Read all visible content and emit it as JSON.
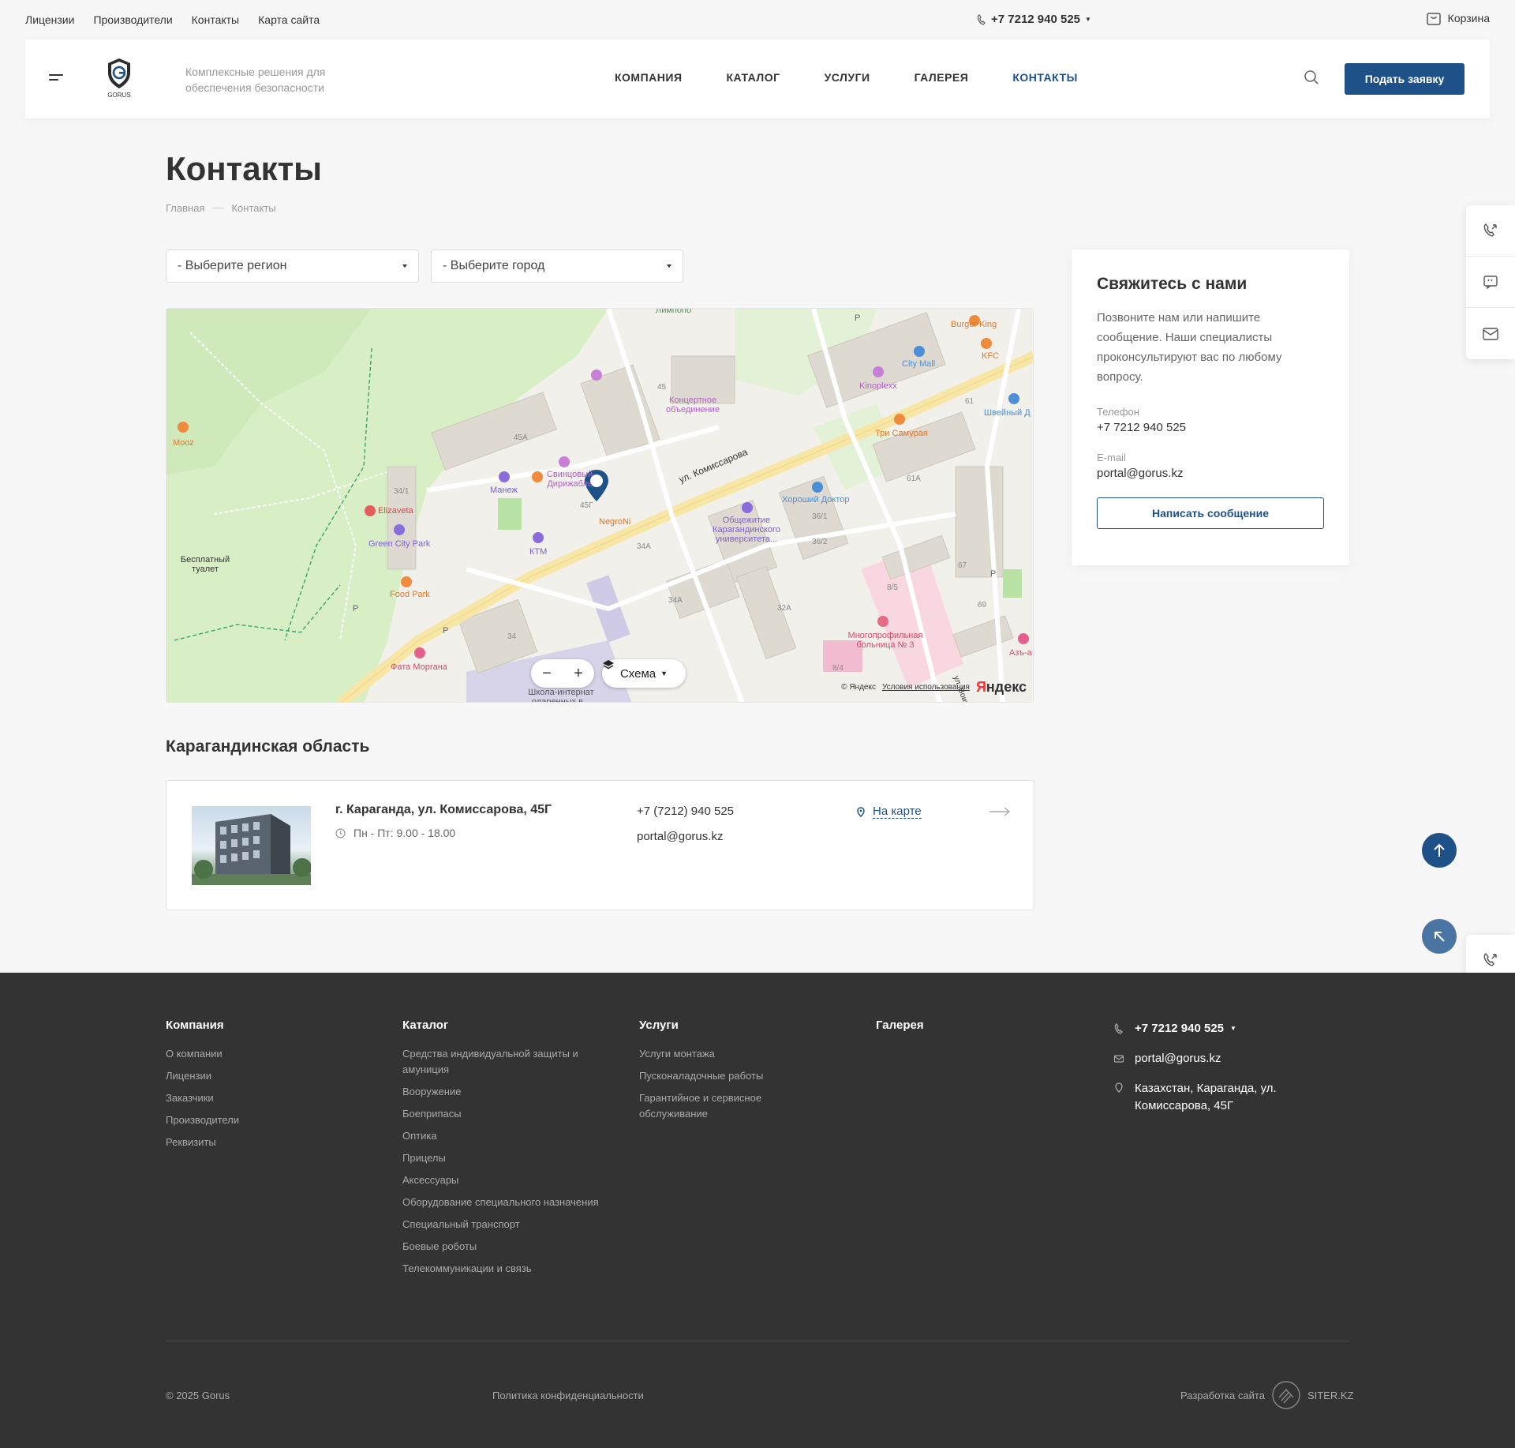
{
  "topbar": {
    "links": [
      "Лицензии",
      "Производители",
      "Контакты",
      "Карта сайта"
    ],
    "phone": "+7 7212 940 525",
    "cart": "Корзина"
  },
  "header": {
    "logo_text": "GORUS",
    "slogan": "Комплексные решения для обеспечения безопасности",
    "nav": [
      "КОМПАНИЯ",
      "КАТАЛОГ",
      "УСЛУГИ",
      "ГАЛЕРЕЯ",
      "КОНТАКТЫ"
    ],
    "apply_button": "Подать заявку"
  },
  "page": {
    "title": "Контакты",
    "breadcrumb": [
      "Главная",
      "Контакты"
    ]
  },
  "filters": {
    "region": "- Выберите регион",
    "city": "- Выберите город"
  },
  "map": {
    "labels": [
      "Лимпопо",
      "Burger King",
      "City Mall",
      "KFC",
      "Kinoplexx",
      "Концертное объединение",
      "45",
      "61",
      "Швейный Д",
      "Mooz",
      "45А",
      "Манеж",
      "Три Самурая",
      "Свинцовый Дирижабль",
      "ул. Комиссарова",
      "34/1",
      "Elizaveta",
      "45Г",
      "NegroNi",
      "Хороший Доктор",
      "61А",
      "Green City Park",
      "КТМ",
      "Общежитие Карагандинского университета...",
      "36/1",
      "36/2",
      "34А",
      "Бесплатный туалет",
      "Food Park",
      "8/5",
      "67",
      "34А",
      "32А",
      "69",
      "Многопрофильная больница № 3",
      "34",
      "ул. Воинов-Инт",
      "Азъ-а",
      "8/4",
      "Фата Моргана",
      "Школа-интернат одаренных в...",
      "P"
    ],
    "layer_button": "Схема",
    "copyright": "© Яндекс",
    "terms": "Условия использования",
    "brand_first": "Я",
    "brand_rest": "ндекс"
  },
  "region": {
    "title": "Карагандинская область",
    "office": {
      "address": "г. Караганда, ул. Комиссарова, 45Г",
      "hours": "Пн - Пт: 9.00 - 18.00",
      "phone": "+7 (7212) 940 525",
      "email": "portal@gorus.kz",
      "map_link": "На карте"
    }
  },
  "contact_card": {
    "title": "Свяжитесь с нами",
    "description": "Позвоните нам или напишите сообщение. Наши специалисты проконсультируют вас по любому вопросу.",
    "phone_label": "Телефон",
    "phone": "+7 7212 940 525",
    "email_label": "E-mail",
    "email": "portal@gorus.kz",
    "button": "Написать сообщение"
  },
  "footer": {
    "columns": [
      {
        "title": "Компания",
        "items": [
          "О компании",
          "Лицензии",
          "Заказчики",
          "Производители",
          "Реквизиты"
        ]
      },
      {
        "title": "Каталог",
        "items": [
          "Средства индивидуальной защиты и амуниция",
          "Вооружение",
          "Боеприпасы",
          "Оптика",
          "Прицелы",
          "Аксессуары",
          "Оборудование специального назначения",
          "Специальный транспорт",
          "Боевые роботы",
          "Телекоммуникации и связь"
        ]
      },
      {
        "title": "Услуги",
        "items": [
          "Услуги монтажа",
          "Пусконаладочные работы",
          "Гарантийное и сервисное обслуживание"
        ]
      },
      {
        "title": "Галерея",
        "items": []
      }
    ],
    "phone": "+7 7212 940 525",
    "email": "portal@gorus.kz",
    "address": "Казахстан, Караганда, ул. Комиссарова, 45Г",
    "copyright": "© 2025 Gorus",
    "privacy": "Политика конфиденциальности",
    "dev_label": "Разработка сайта",
    "dev_name": "SITER.KZ"
  },
  "colors": {
    "brand": "#1f5189",
    "footer_bg": "#333333",
    "page_bg": "#f7f7f7"
  }
}
